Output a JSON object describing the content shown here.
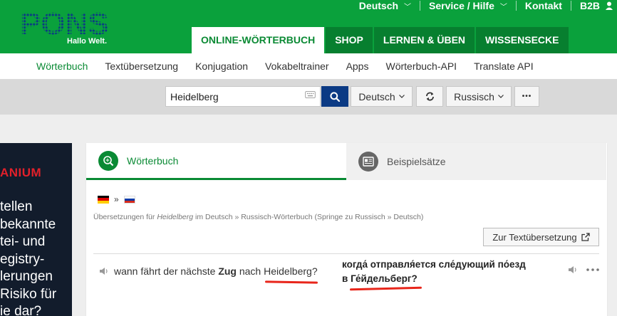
{
  "brand": {
    "logo": "PONS",
    "tagline": "Hallo Welt."
  },
  "topnav": [
    {
      "label": "Deutsch",
      "caret": true
    },
    {
      "label": "Service / Hilfe",
      "caret": true
    },
    {
      "label": "Kontakt",
      "caret": false
    },
    {
      "label": "B2B",
      "caret": false
    }
  ],
  "main_tabs": [
    "ONLINE-WÖRTERBUCH",
    "SHOP",
    "LERNEN & ÜBEN",
    "WISSENSECKE"
  ],
  "subnav": [
    "Wörterbuch",
    "Textübersetzung",
    "Konjugation",
    "Vokabeltrainer",
    "Apps",
    "Wörterbuch-API",
    "Translate API"
  ],
  "search": {
    "value": "Heidelberg",
    "source_lang": "Deutsch",
    "target_lang": "Russisch",
    "more": "•••"
  },
  "ad": {
    "brand": "ANIUM",
    "lines": [
      "tellen",
      "bekannte",
      "tei- und",
      "egistry-",
      "lerungen",
      "Risiko für",
      "ie dar?"
    ]
  },
  "card": {
    "tab_dictionary": "Wörterbuch",
    "tab_examples": "Beispielsätze",
    "breadcrumb_prefix": "Übersetzungen für",
    "breadcrumb_term": "Heidelberg",
    "breadcrumb_suffix": "im Deutsch » Russisch-Wörterbuch (Springe zu Russisch » Deutsch)",
    "text_translation_button": "Zur Textübersetzung",
    "example": {
      "src_a": "wann fährt der nächste",
      "src_bold": "Zug",
      "src_b": "nach",
      "src_term": "Heidelberg?",
      "tgt_line1": "когда́ отправля́ется сле́дующий по́езд",
      "tgt_prefix": "в",
      "tgt_term": "Ге́йдельберг?"
    }
  },
  "colors": {
    "green": "#0aa13c",
    "dark_green": "#077f2f",
    "navy": "#0b3a84",
    "annotation_red": "#e8261b"
  }
}
